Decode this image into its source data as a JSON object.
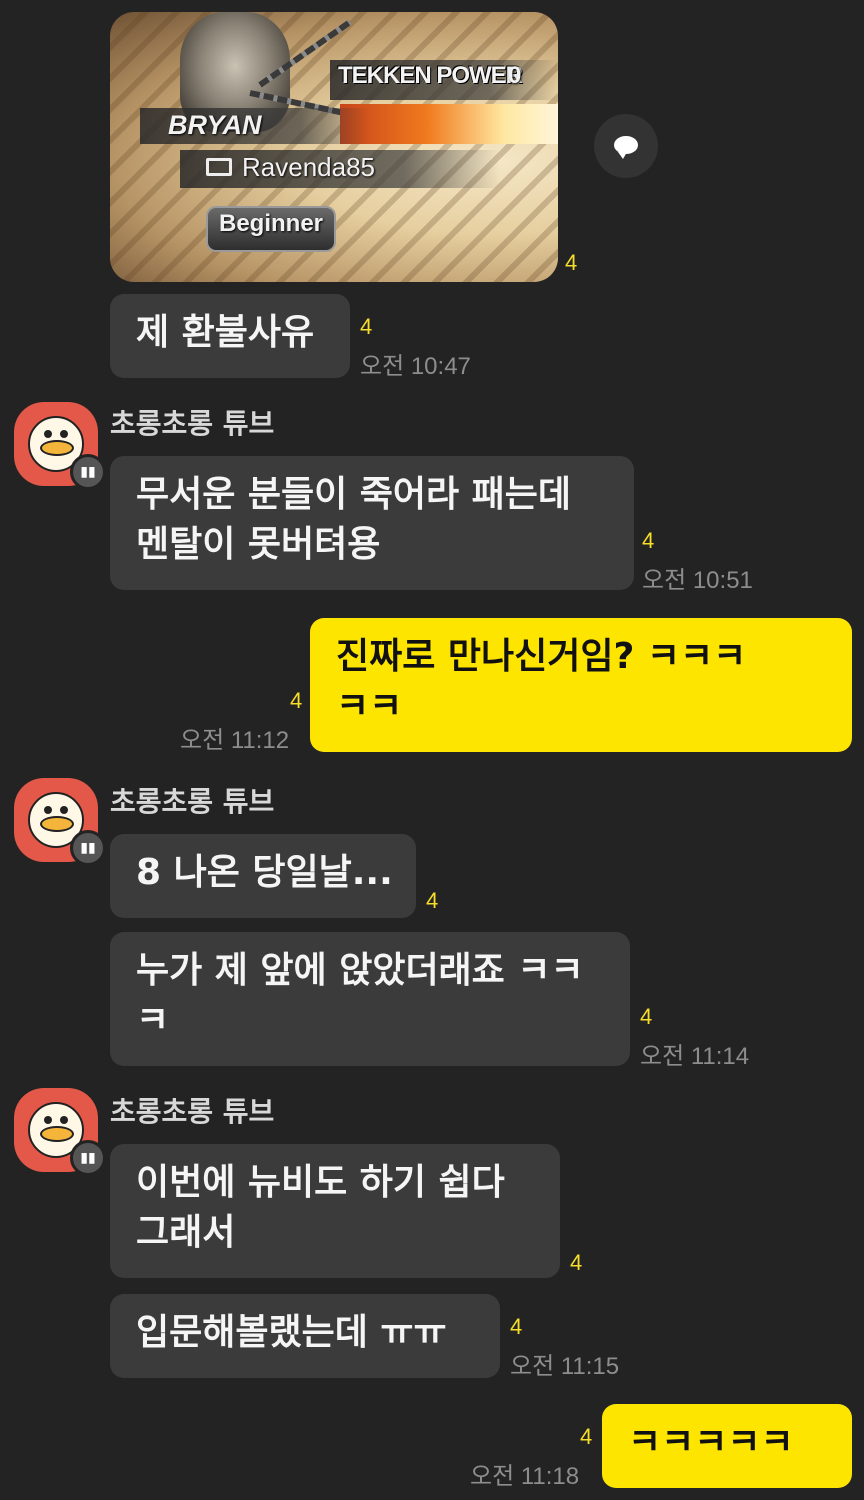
{
  "game_card": {
    "character": "BRYAN",
    "power_label": "TEKKEN POWER",
    "power_value": "0",
    "player_name": "Ravenda85",
    "rank": "Beginner"
  },
  "messages": [
    {
      "id": "m1",
      "unread": "4"
    },
    {
      "id": "m2",
      "lines": [
        "제 환불사유"
      ],
      "unread": "4",
      "time": "오전 10:47"
    },
    {
      "id": "m3",
      "sender": "초롱초롱 튜브",
      "lines": [
        "무서운 분들이 죽어라 패는데",
        "멘탈이 못버텨용"
      ],
      "unread": "4",
      "time": "오전 10:51"
    },
    {
      "id": "m4",
      "lines": [
        "진짜로 만나신거임? ㅋㅋㅋ",
        "ㅋㅋ"
      ],
      "unread": "4",
      "time": "오전 11:12"
    },
    {
      "id": "m5",
      "sender": "초롱초롱 튜브",
      "lines": [
        "8 나온 당일날..."
      ],
      "unread": "4"
    },
    {
      "id": "m6",
      "lines": [
        "누가 제 앞에 앉았더래죠 ㅋㅋ",
        "ㅋ"
      ],
      "unread": "4",
      "time": "오전 11:14"
    },
    {
      "id": "m7",
      "sender": "초롱초롱 튜브",
      "lines": [
        "이번에 뉴비도 하기 쉽다",
        "그래서"
      ],
      "unread": "4"
    },
    {
      "id": "m8",
      "lines": [
        "입문해볼랬는데 ㅠㅠ"
      ],
      "unread": "4",
      "time": "오전 11:15"
    },
    {
      "id": "m9",
      "lines": [
        "ㅋㅋㅋㅋㅋ"
      ],
      "unread": "4",
      "time": "오전 11:18"
    }
  ],
  "icons": {
    "share": "speech-bubble-icon",
    "avatar": "duck-character-avatar",
    "avatar_tag": "chat-badge-icon"
  },
  "colors": {
    "background": "#232323",
    "bubble_other": "#3b3b3b",
    "bubble_me": "#fee500",
    "unread": "#f7de2a",
    "avatar_bg": "#e35848"
  }
}
